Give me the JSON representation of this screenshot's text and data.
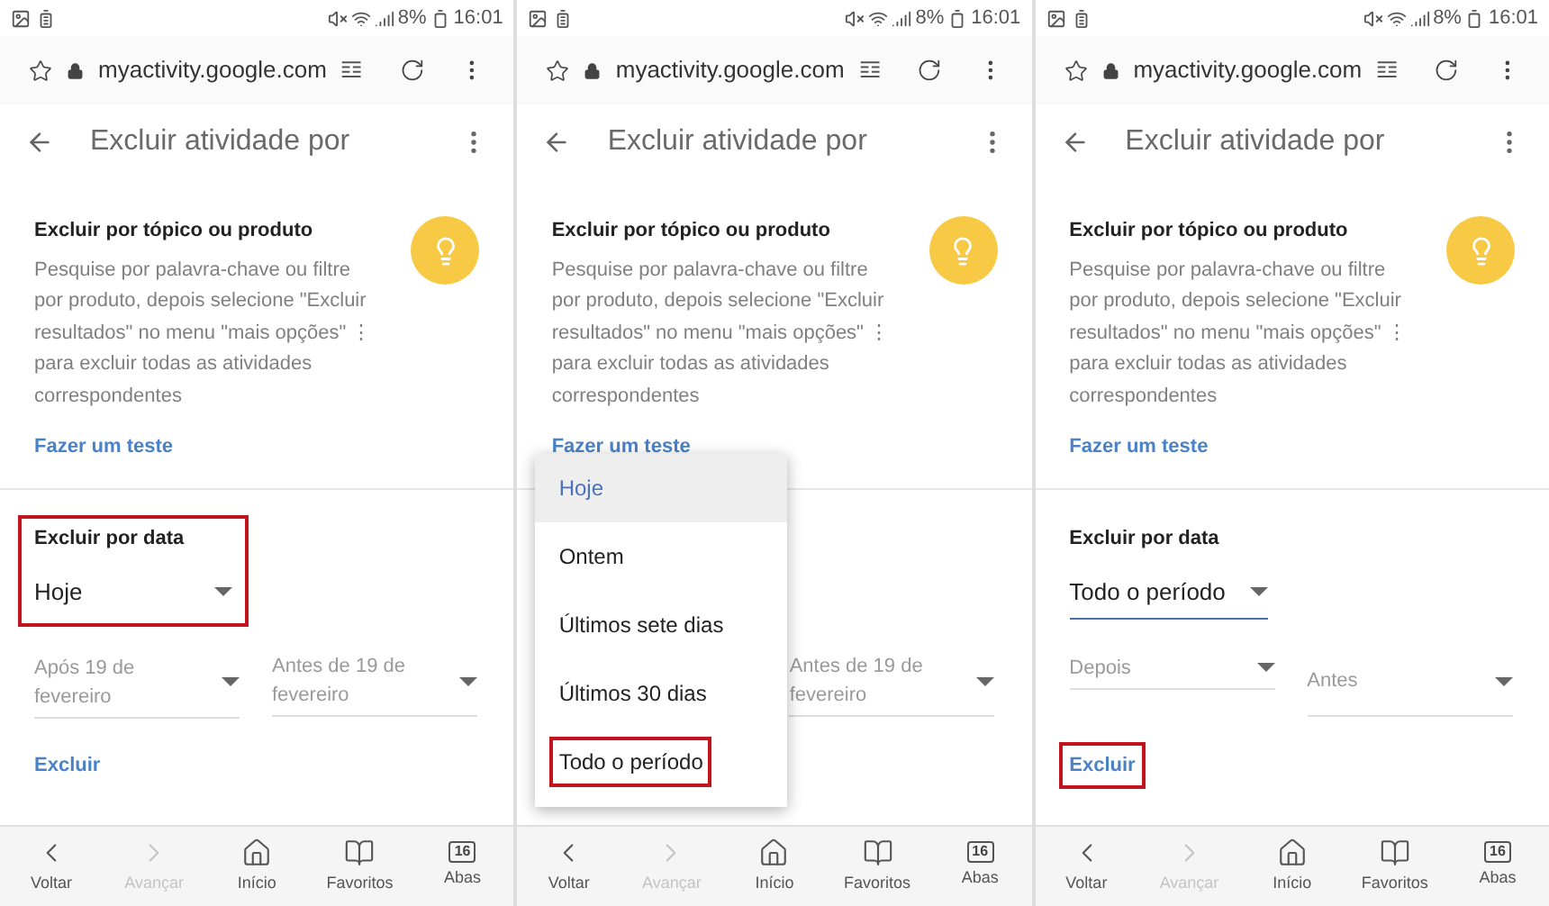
{
  "panels": [
    {
      "status_bar": {
        "battery": "8%",
        "time": "16:01"
      },
      "address_bar": {
        "url": "myactivity.google.com"
      },
      "app_bar": {
        "title": "Excluir atividade por"
      },
      "topic_section": {
        "title": "Excluir por tópico ou produto",
        "description": "Pesquise por palavra-chave ou filtre por produto, depois selecione \"Excluir resultados\" no menu \"mais opções\" ⋮ para excluir todas as atividades correspondentes",
        "link": "Fazer um teste"
      },
      "date_section": {
        "title": "Excluir por data",
        "value": "Hoje",
        "focused": false,
        "highlighted": true
      },
      "after_field": {
        "placeholder": "Após 19 de fevereiro"
      },
      "before_field": {
        "placeholder": "Antes de 19 de fevereiro"
      },
      "delete_link": {
        "label": "Excluir",
        "highlighted": false
      },
      "bottom_nav": {
        "tabs_count": "16",
        "items": [
          {
            "kind": "back",
            "label": "Voltar",
            "disabled": false
          },
          {
            "kind": "forward",
            "label": "Avançar",
            "disabled": true
          },
          {
            "kind": "home",
            "label": "Início",
            "disabled": false
          },
          {
            "kind": "bookmarks",
            "label": "Favoritos",
            "disabled": false
          },
          {
            "kind": "tabs",
            "label": "Abas",
            "disabled": false
          }
        ]
      }
    },
    {
      "status_bar": {
        "battery": "8%",
        "time": "16:01"
      },
      "address_bar": {
        "url": "myactivity.google.com"
      },
      "app_bar": {
        "title": "Excluir atividade por"
      },
      "topic_section": {
        "title": "Excluir por tópico ou produto",
        "description": "Pesquise por palavra-chave ou filtre por produto, depois selecione \"Excluir resultados\" no menu \"mais opções\" ⋮ para excluir todas as atividades correspondentes",
        "link": "Fazer um teste"
      },
      "before_field": {
        "placeholder": "Antes de 19 de fevereiro"
      },
      "menu": {
        "options": [
          {
            "label": "Hoje",
            "selected": true,
            "highlighted": false
          },
          {
            "label": "Ontem",
            "selected": false,
            "highlighted": false
          },
          {
            "label": "Últimos sete dias",
            "selected": false,
            "highlighted": false
          },
          {
            "label": "Últimos 30 dias",
            "selected": false,
            "highlighted": false
          },
          {
            "label": "Todo o período",
            "selected": false,
            "highlighted": true
          }
        ]
      },
      "bottom_nav": {
        "tabs_count": "16",
        "items": [
          {
            "kind": "back",
            "label": "Voltar",
            "disabled": false
          },
          {
            "kind": "forward",
            "label": "Avançar",
            "disabled": true
          },
          {
            "kind": "home",
            "label": "Início",
            "disabled": false
          },
          {
            "kind": "bookmarks",
            "label": "Favoritos",
            "disabled": false
          },
          {
            "kind": "tabs",
            "label": "Abas",
            "disabled": false
          }
        ]
      }
    },
    {
      "status_bar": {
        "battery": "8%",
        "time": "16:01"
      },
      "address_bar": {
        "url": "myactivity.google.com"
      },
      "app_bar": {
        "title": "Excluir atividade por"
      },
      "topic_section": {
        "title": "Excluir por tópico ou produto",
        "description": "Pesquise por palavra-chave ou filtre por produto, depois selecione \"Excluir resultados\" no menu \"mais opções\" ⋮ para excluir todas as atividades correspondentes",
        "link": "Fazer um teste"
      },
      "date_section": {
        "title": "Excluir por data",
        "value": "Todo o período",
        "focused": true,
        "highlighted": false
      },
      "after_field": {
        "placeholder": "Depois"
      },
      "before_field": {
        "placeholder": "Antes"
      },
      "delete_link": {
        "label": "Excluir",
        "highlighted": true
      },
      "bottom_nav": {
        "tabs_count": "16",
        "items": [
          {
            "kind": "back",
            "label": "Voltar",
            "disabled": false
          },
          {
            "kind": "forward",
            "label": "Avançar",
            "disabled": true
          },
          {
            "kind": "home",
            "label": "Início",
            "disabled": false
          },
          {
            "kind": "bookmarks",
            "label": "Favoritos",
            "disabled": false
          },
          {
            "kind": "tabs",
            "label": "Abas",
            "disabled": false
          }
        ]
      }
    }
  ]
}
